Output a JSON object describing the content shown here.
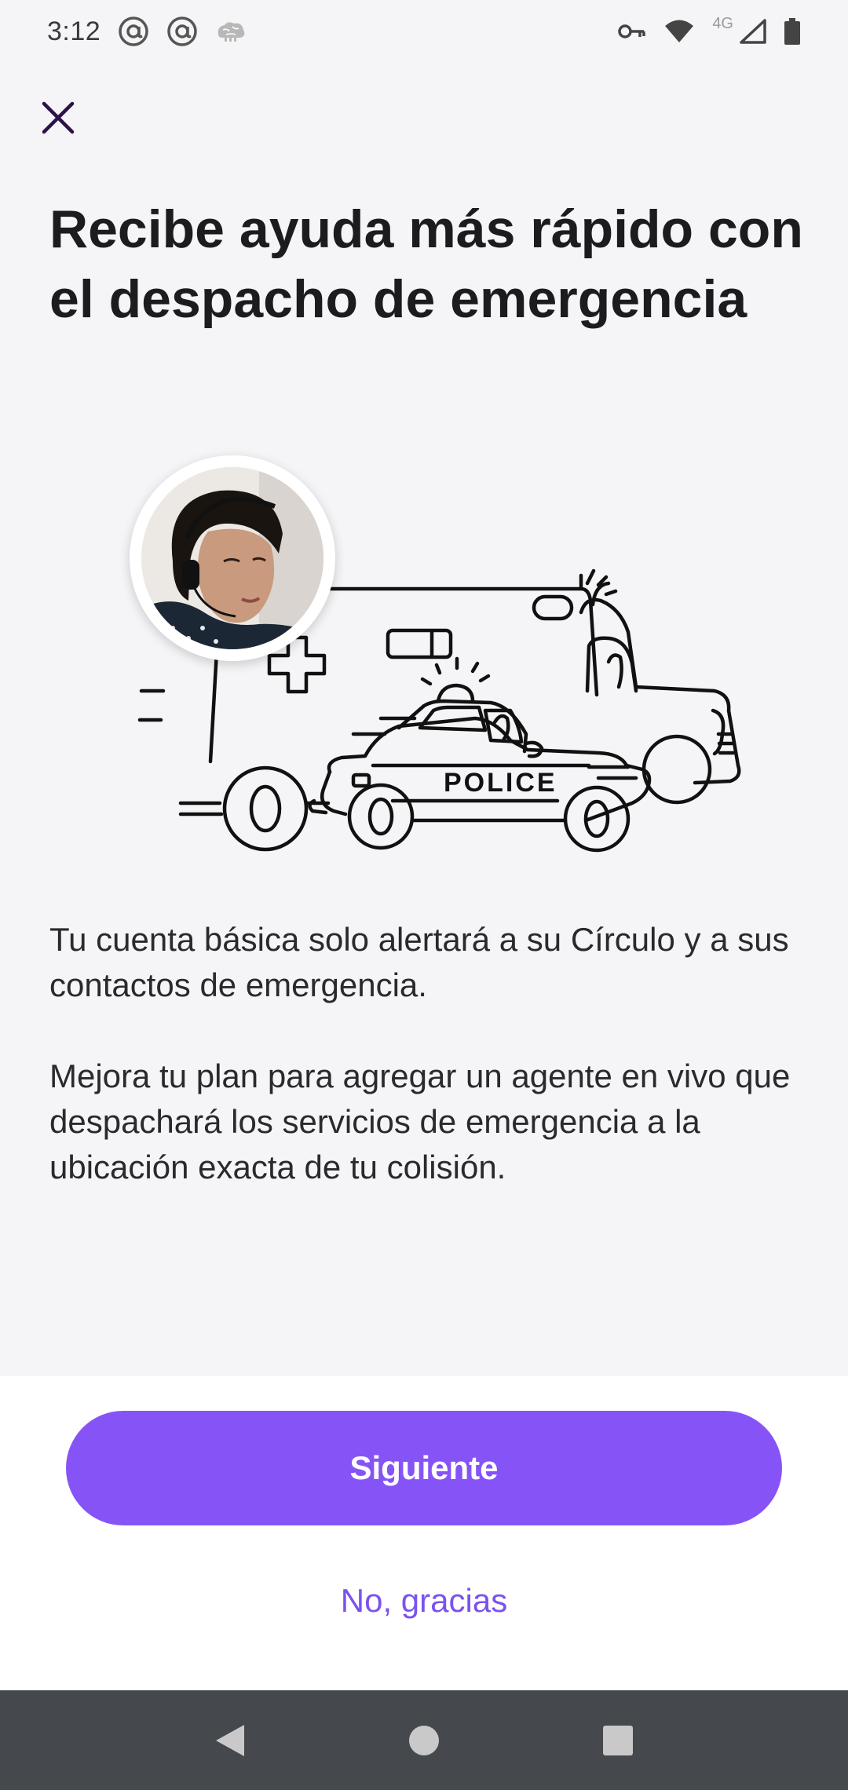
{
  "status_bar": {
    "time": "3:12",
    "network_type": "4G",
    "left_icons": [
      "at-sign-icon",
      "at-sign-icon",
      "brain-icon"
    ],
    "right_icons": [
      "vpn-key-icon",
      "wifi-icon",
      "signal-icon",
      "battery-icon"
    ]
  },
  "header": {
    "close_icon": "close-icon"
  },
  "main": {
    "title": "Recibe ayuda más rápido con el despacho de emergencia",
    "illustration_text": "POLICE",
    "paragraphs": [
      "Tu cuenta básica solo alertará a su Círculo y a sus contactos de emergencia.",
      "Mejora tu plan para agregar un agente en vivo que despachará los servicios de emergencia a la ubicación exacta de tu colisión."
    ]
  },
  "actions": {
    "primary_label": "Siguiente",
    "secondary_label": "No, gracias"
  },
  "nav_bar": {
    "icons": [
      "back-icon",
      "home-icon",
      "recents-icon"
    ]
  },
  "colors": {
    "accent": "#8654f6",
    "link": "#7b52ee",
    "background": "#f5f5f7",
    "nav_bar": "#45484c",
    "close_icon": "#2b1247"
  }
}
